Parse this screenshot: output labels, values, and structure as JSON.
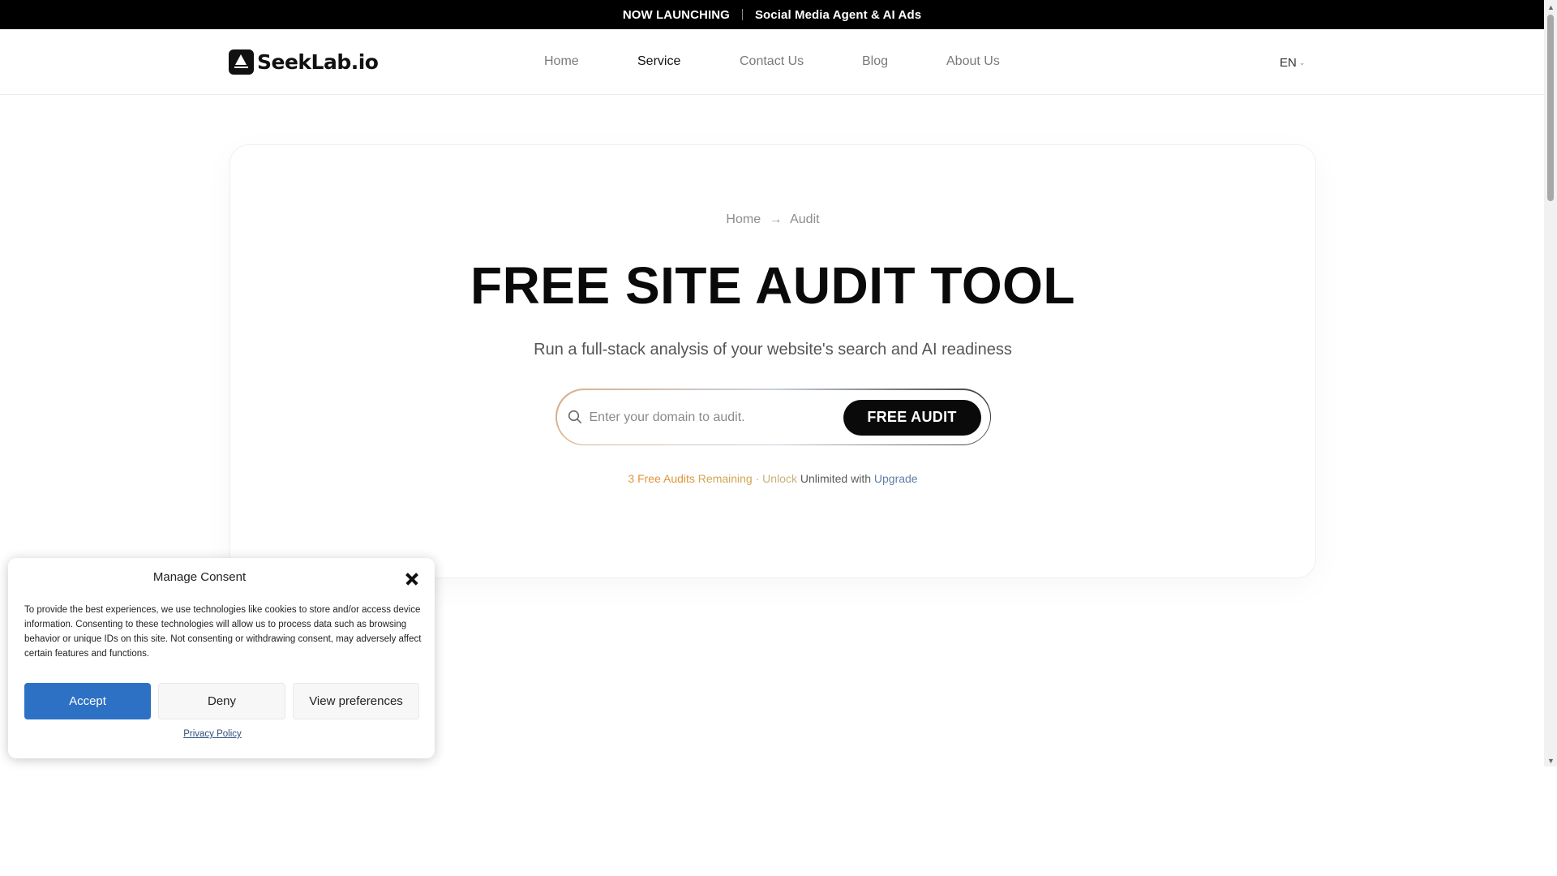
{
  "announcement": {
    "tag": "NOW LAUNCHING",
    "text": "Social Media Agent & AI Ads"
  },
  "header": {
    "logo_text": "SeekLab.io",
    "nav": [
      {
        "label": "Home",
        "active": false
      },
      {
        "label": "Service",
        "active": true
      },
      {
        "label": "Contact Us",
        "active": false
      },
      {
        "label": "Blog",
        "active": false
      },
      {
        "label": "About Us",
        "active": false
      }
    ],
    "language": "EN"
  },
  "hero": {
    "breadcrumb": [
      "Home",
      "Audit"
    ],
    "title": "FREE SITE AUDIT TOOL",
    "subtitle": "Run a full-stack analysis of your website's search and AI readiness",
    "search": {
      "placeholder": "Enter your domain to audit.",
      "value": "",
      "button_label": "FREE AUDIT"
    },
    "remaining": {
      "part1": "3 Free Audits",
      "part2": "Remaining ·",
      "part3": "Unlock",
      "part4": "Unlimited with",
      "part5": "Upgrade"
    }
  },
  "consent": {
    "title": "Manage Consent",
    "body": "To provide the best experiences, we use technologies like cookies to store and/or access device information. Consenting to these technologies will allow us to process data such as browsing behavior or unique IDs on this site. Not consenting or withdrawing consent, may adversely affect certain features and functions.",
    "accept_label": "Accept",
    "deny_label": "Deny",
    "preferences_label": "View preferences",
    "privacy_label": "Privacy Policy"
  },
  "colors": {
    "accent_button": "#0a0a0a",
    "accept_blue": "#2c71c4",
    "upgrade_link": "#5d7fa6",
    "remaining_orange": "#e0953b"
  }
}
